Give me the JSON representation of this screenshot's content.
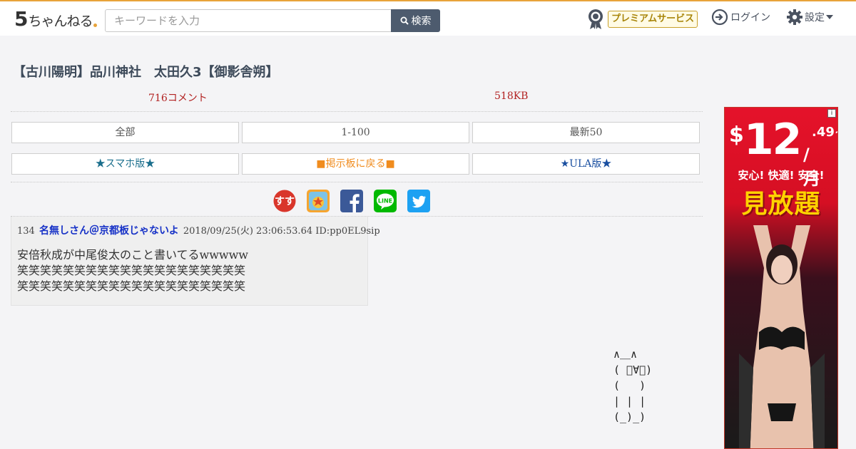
{
  "header": {
    "logo_five": "5",
    "logo_text": "ちゃんねる",
    "search_placeholder": "キーワードを入力",
    "search_button": "検索",
    "premium_label": "プレミアムサービス",
    "login_label": "ログイン",
    "settings_label": "設定"
  },
  "thread": {
    "title": "【古川陽明】品川神社　太田久3【御影舎朔】",
    "comment_count": "716コメント",
    "size": "518KB"
  },
  "nav": {
    "row1": [
      "全部",
      "1-100",
      "最新50"
    ],
    "row2": [
      "★スマホ版★",
      "■掲示板に戻る■",
      "★ULA版★"
    ]
  },
  "share_icons": [
    "sumaho-matome-icon",
    "bookmark-app-icon",
    "facebook-icon",
    "line-icon",
    "twitter-icon"
  ],
  "share_labels": {
    "sumaho": "すす",
    "line": "LINE"
  },
  "post": {
    "number": "134",
    "name": "名無しさん＠京都板じゃないよ",
    "datetime": "2018/09/25(火) 23:06:53.64",
    "id": "ID:pp0EL9sip",
    "body_lines": [
      "安倍秋成が中尾俊太のこと書いてるwwwww",
      "笑笑笑笑笑笑笑笑笑笑笑笑笑笑笑笑笑笑笑笑",
      "笑笑笑笑笑笑笑笑笑笑笑笑笑笑笑笑笑笑笑笑"
    ]
  },
  "ascii_art": "∧＿∧\n( ﾟ∀ﾟ)\n(   )\n| | |\n(_)_)",
  "ad": {
    "info": "i",
    "currency": "$",
    "price_big": "12",
    "price_small": ".49~",
    "per": "/月",
    "tagline": "安心! 快適! 安全!",
    "headline": "見放題"
  },
  "colors": {
    "accent": "#e8a33a",
    "search_button": "#4d5b6e",
    "meta_red": "#b22222",
    "name_blue": "#1732c7",
    "nav_orange": "#f08c1e"
  }
}
